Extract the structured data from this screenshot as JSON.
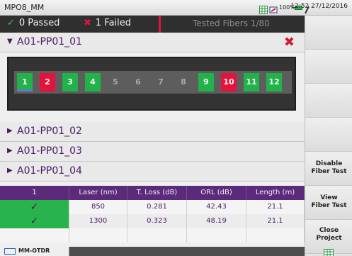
{
  "window": {
    "title": "MPO8_MM",
    "battery": "100%",
    "clock": "12:52 27/12/2016"
  },
  "status": {
    "passed": "0 Passed",
    "failed": "1 Failed",
    "tested": "Tested Fibers 1/80"
  },
  "groups": [
    {
      "label": "A01-PP01_01",
      "expanded": true
    },
    {
      "label": "A01-PP01_02",
      "expanded": false
    },
    {
      "label": "A01-PP01_03",
      "expanded": false
    },
    {
      "label": "A01-PP01_04",
      "expanded": false
    }
  ],
  "fibers": [
    {
      "num": "1",
      "state": "pass",
      "selected": true
    },
    {
      "num": "2",
      "state": "fail"
    },
    {
      "num": "3",
      "state": "pass"
    },
    {
      "num": "4",
      "state": "pass"
    },
    {
      "num": "5",
      "state": "none"
    },
    {
      "num": "6",
      "state": "none"
    },
    {
      "num": "7",
      "state": "none"
    },
    {
      "num": "8",
      "state": "none"
    },
    {
      "num": "9",
      "state": "pass"
    },
    {
      "num": "10",
      "state": "fail"
    },
    {
      "num": "11",
      "state": "pass"
    },
    {
      "num": "12",
      "state": "pass"
    }
  ],
  "table": {
    "headers": [
      "1",
      "Laser (nm)",
      "T. Loss (dB)",
      "ORL (dB)",
      "Length (m)"
    ],
    "rows": [
      [
        "✓",
        "850",
        "0.281",
        "42.43",
        "21.1"
      ],
      [
        "✓",
        "1300",
        "0.323",
        "48.19",
        "21.1"
      ]
    ]
  },
  "sidebar": {
    "disable_l1": "Disable",
    "disable_l2": "Fiber Test",
    "view_l1": "View",
    "view_l2": "Fiber Test",
    "close_l1": "Close",
    "close_l2": "Project"
  },
  "bottom_tab": {
    "label": "MM-OTDR"
  },
  "colors": {
    "pass": "#22b24a",
    "fail": "#e3133d",
    "accent": "#5b2a7a"
  }
}
